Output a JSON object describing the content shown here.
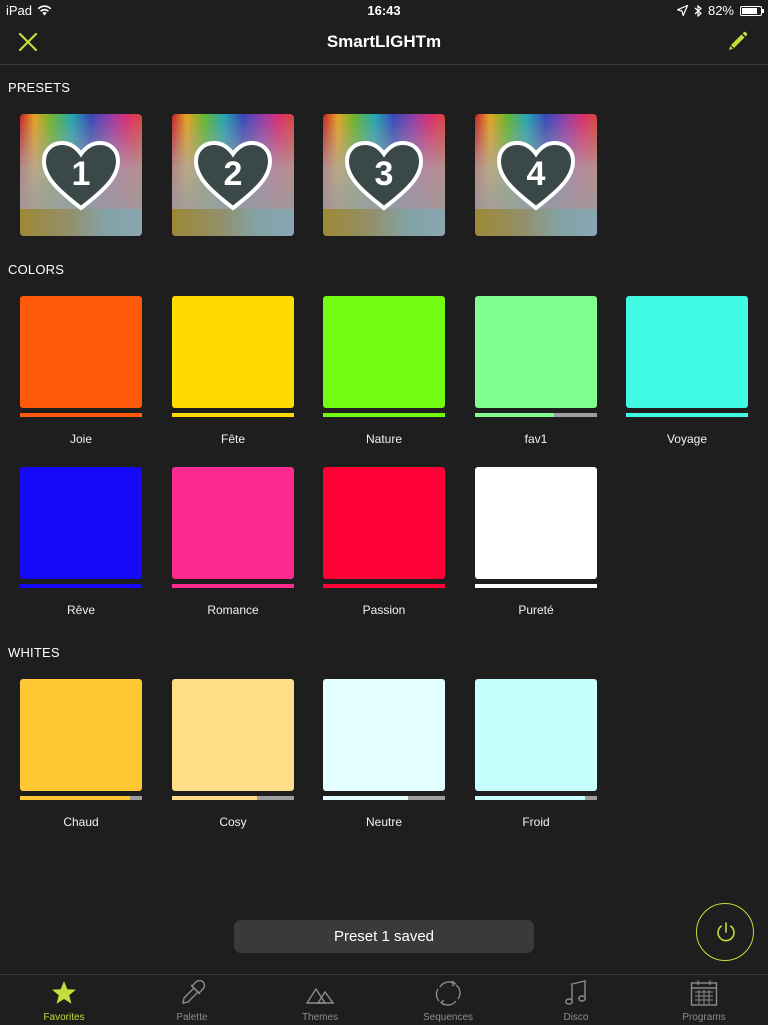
{
  "status_bar": {
    "device": "iPad",
    "time": "16:43",
    "battery": "82%",
    "battery_level": 0.82
  },
  "nav": {
    "title": "SmartLIGHTm",
    "accent_color": "#c5dc3e"
  },
  "sections": {
    "presets": "PRESETS",
    "colors": "COLORS",
    "whites": "WHITES"
  },
  "presets": [
    {
      "number": "1"
    },
    {
      "number": "2"
    },
    {
      "number": "3"
    },
    {
      "number": "4"
    }
  ],
  "colors": [
    {
      "name": "Joie",
      "color": "#ff5a0a",
      "level": 1.0
    },
    {
      "name": "Fête",
      "color": "#ffdb00",
      "level": 1.0
    },
    {
      "name": "Nature",
      "color": "#72fc12",
      "level": 1.0
    },
    {
      "name": "fav1",
      "color": "#80ff8e",
      "level": 0.65
    },
    {
      "name": "Voyage",
      "color": "#42fbe4",
      "level": 1.0
    },
    {
      "name": "Rêve",
      "color": "#1609f7",
      "level": 1.0
    },
    {
      "name": "Romance",
      "color": "#ff2a8f",
      "level": 1.0
    },
    {
      "name": "Passion",
      "color": "#ff0036",
      "level": 1.0
    },
    {
      "name": "Pureté",
      "color": "#ffffff",
      "level": 1.0
    }
  ],
  "whites": [
    {
      "name": "Chaud",
      "color": "#ffc733",
      "level": 0.9
    },
    {
      "name": "Cosy",
      "color": "#ffde87",
      "level": 0.7
    },
    {
      "name": "Neutre",
      "color": "#e3ffff",
      "level": 0.7
    },
    {
      "name": "Froid",
      "color": "#c7fffe",
      "level": 0.9
    }
  ],
  "toast": "Preset 1 saved",
  "tabs": [
    {
      "label": "Favorites",
      "icon": "star-icon",
      "active": true
    },
    {
      "label": "Palette",
      "icon": "dropper-icon",
      "active": false
    },
    {
      "label": "Themes",
      "icon": "mountains-icon",
      "active": false
    },
    {
      "label": "Sequences",
      "icon": "cycle-arrows-icon",
      "active": false
    },
    {
      "label": "Disco",
      "icon": "music-note-icon",
      "active": false
    },
    {
      "label": "Programs",
      "icon": "calendar-icon",
      "active": false
    }
  ]
}
